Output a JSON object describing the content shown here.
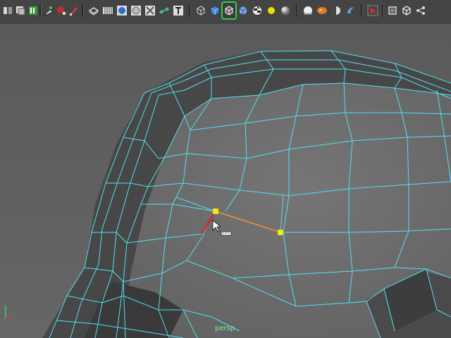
{
  "viewport": {
    "camera_label": "persp"
  },
  "toolbar": {
    "buttons": [
      {
        "icon": "select-by-hierarchy-icon"
      },
      {
        "icon": "select-by-object-icon"
      },
      {
        "icon": "select-by-component-icon"
      },
      {
        "icon": "lock-selection-icon"
      },
      {
        "icon": "snap-magnet-icon"
      },
      {
        "icon": "paint-tool-icon"
      },
      {
        "icon": "wireframe-shade-icon"
      },
      {
        "icon": "grid-toggle-icon"
      },
      {
        "icon": "smooth-shade-icon"
      },
      {
        "icon": "flat-shade-icon"
      },
      {
        "icon": "xray-icon"
      },
      {
        "icon": "joints-icon"
      },
      {
        "icon": "text-tool-icon"
      },
      {
        "icon": "cube-wire-icon"
      },
      {
        "icon": "cube-shaded-icon"
      },
      {
        "icon": "cube-wire-on-shaded-icon"
      },
      {
        "icon": "cube-textured-icon"
      },
      {
        "icon": "checker-texture-icon"
      },
      {
        "icon": "light-bulb-icon"
      },
      {
        "icon": "sphere-shade-icon"
      },
      {
        "icon": "sphere-highlight-icon"
      },
      {
        "icon": "material-ball-icon"
      },
      {
        "icon": "half-shade-icon"
      },
      {
        "icon": "isolate-select-icon"
      },
      {
        "icon": "cursor-select-icon"
      },
      {
        "icon": "hud-toggle-icon"
      },
      {
        "icon": "cube-frame-icon"
      },
      {
        "icon": "share-nodes-icon"
      }
    ],
    "active_icon": "cube-wire-on-shaded-icon"
  },
  "colors": {
    "toolbar_bg": "#444444",
    "mesh_face": "#6f6f6f",
    "mesh_dark": "#474747",
    "wire": "#52e0f0",
    "selected_vertex": "#f2f200",
    "selected_edge_red": "#e02020",
    "selected_edge_orange": "#f0902a",
    "camera_label": "#7cf08a"
  }
}
